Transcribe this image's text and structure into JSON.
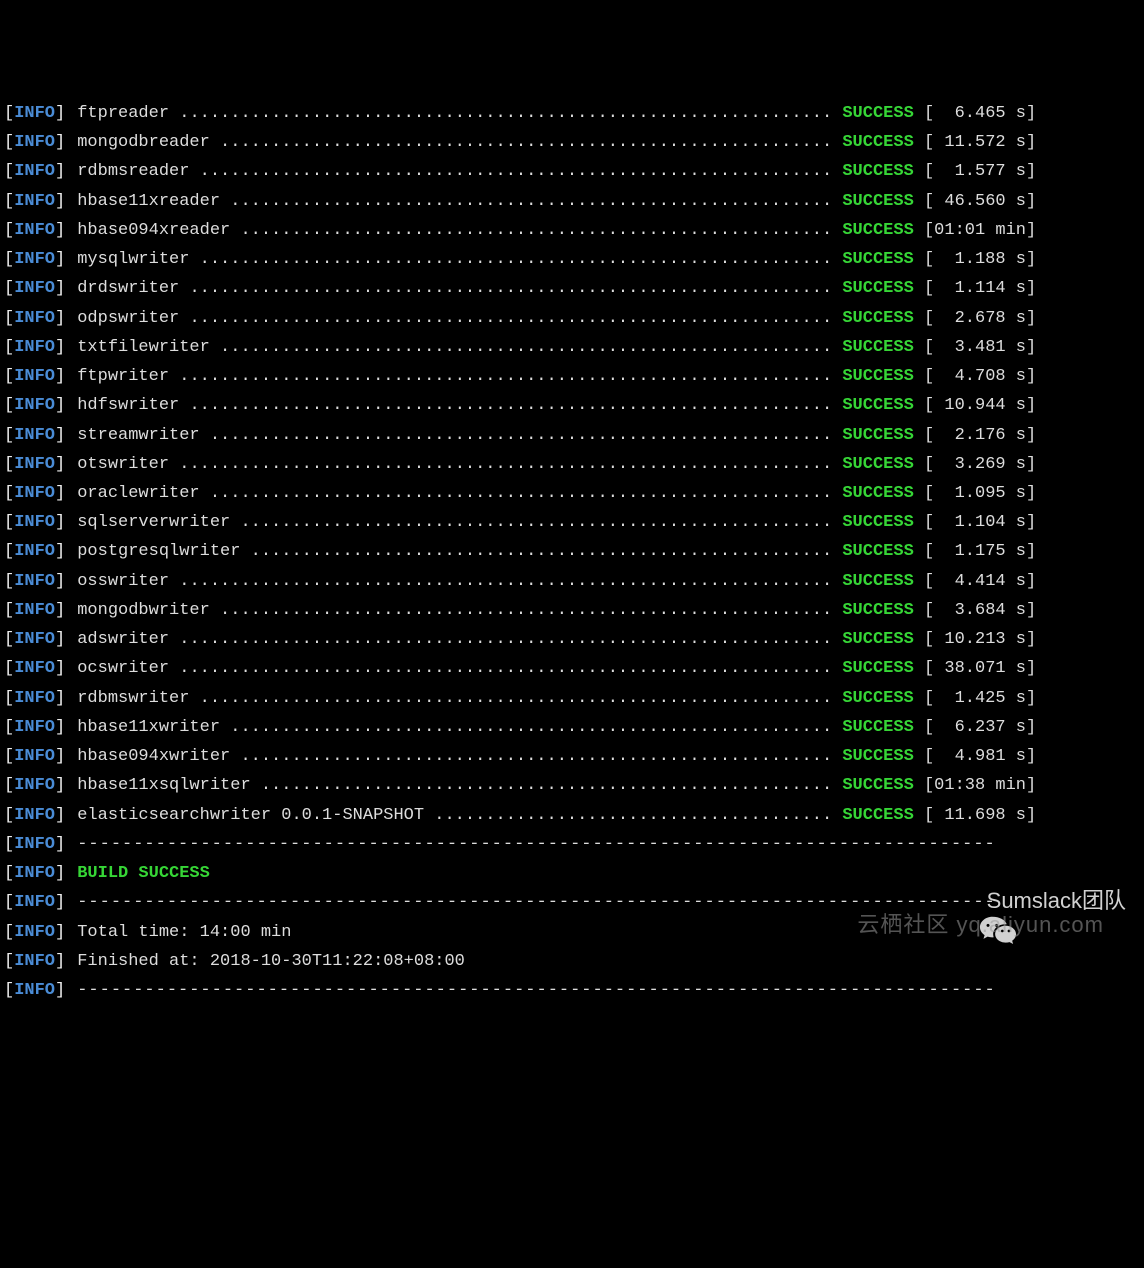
{
  "log_level": "INFO",
  "status_label": "SUCCESS",
  "lines": [
    {
      "module": "ftpreader",
      "time": "  6.465 s"
    },
    {
      "module": "mongodbreader",
      "time": " 11.572 s"
    },
    {
      "module": "rdbmsreader",
      "time": "  1.577 s"
    },
    {
      "module": "hbase11xreader",
      "time": " 46.560 s"
    },
    {
      "module": "hbase094xreader",
      "time": "01:01 min"
    },
    {
      "module": "mysqlwriter",
      "time": "  1.188 s"
    },
    {
      "module": "drdswriter",
      "time": "  1.114 s"
    },
    {
      "module": "odpswriter",
      "time": "  2.678 s"
    },
    {
      "module": "txtfilewriter",
      "time": "  3.481 s"
    },
    {
      "module": "ftpwriter",
      "time": "  4.708 s"
    },
    {
      "module": "hdfswriter",
      "time": " 10.944 s"
    },
    {
      "module": "streamwriter",
      "time": "  2.176 s"
    },
    {
      "module": "otswriter",
      "time": "  3.269 s"
    },
    {
      "module": "oraclewriter",
      "time": "  1.095 s"
    },
    {
      "module": "sqlserverwriter",
      "time": "  1.104 s"
    },
    {
      "module": "postgresqlwriter",
      "time": "  1.175 s"
    },
    {
      "module": "osswriter",
      "time": "  4.414 s"
    },
    {
      "module": "mongodbwriter",
      "time": "  3.684 s"
    },
    {
      "module": "adswriter",
      "time": " 10.213 s"
    },
    {
      "module": "ocswriter",
      "time": " 38.071 s"
    },
    {
      "module": "rdbmswriter",
      "time": "  1.425 s"
    },
    {
      "module": "hbase11xwriter",
      "time": "  6.237 s"
    },
    {
      "module": "hbase094xwriter",
      "time": "  4.981 s"
    },
    {
      "module": "hbase11xsqlwriter",
      "time": "01:38 min"
    },
    {
      "module": "elasticsearchwriter 0.0.1-SNAPSHOT",
      "time": " 11.698 s"
    }
  ],
  "build_success": "BUILD SUCCESS",
  "total_time": "Total time: 14:00 min",
  "finished_at": "Finished at: 2018-10-30T11:22:08+08:00",
  "divider": "----------------------------------------------------------------------------------",
  "watermark1": "Sumslack团队",
  "watermark2": "云栖社区 yq.aliyun.com"
}
